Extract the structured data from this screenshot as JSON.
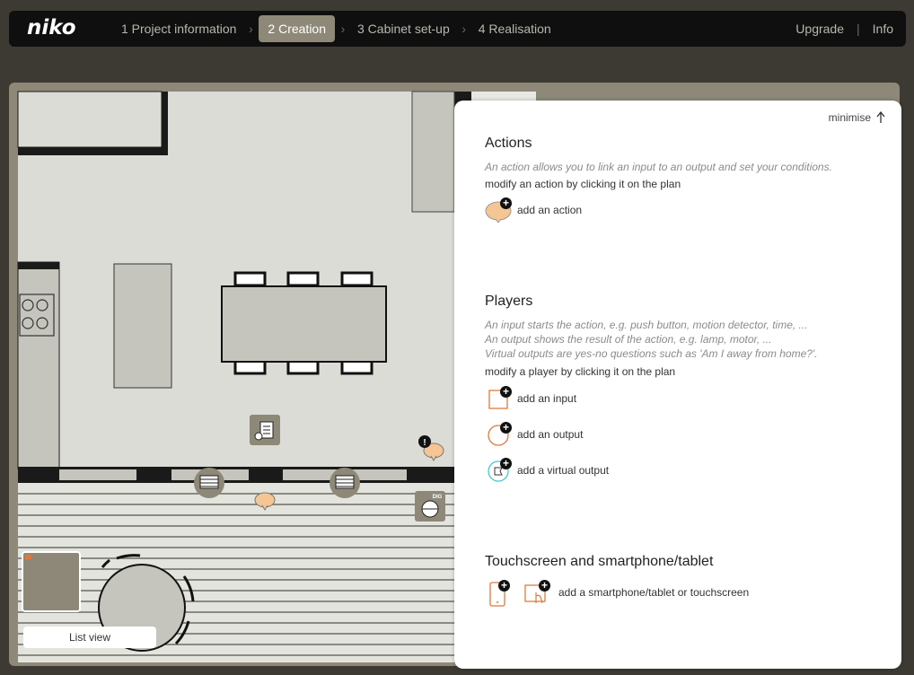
{
  "nav": {
    "logo": "niko",
    "steps": [
      {
        "label": "1 Project information"
      },
      {
        "label": "2 Creation",
        "active": true
      },
      {
        "label": "3 Cabinet set-up"
      },
      {
        "label": "4 Realisation"
      }
    ],
    "upgrade_label": "Upgrade",
    "separator": "|",
    "info_label": "Info"
  },
  "panel": {
    "minimise_label": "minimise",
    "actions": {
      "title": "Actions",
      "description": "An action allows you to link an input to an output and set your conditions.",
      "note": "modify an action by clicking it on the plan",
      "add_action_label": "add an action"
    },
    "players": {
      "title": "Players",
      "desc_line1": "An input starts the action, e.g. push button, motion detector, time, ...",
      "desc_line2": "An output shows the result of the action, e.g. lamp, motor, ...",
      "desc_line3": "Virtual outputs are yes-no questions such as 'Am I away from home?'.",
      "note": "modify a player by clicking it on the plan",
      "add_input_label": "add an input",
      "add_output_label": "add an output",
      "add_virtual_label": "add a virtual output"
    },
    "touchscreen": {
      "title": "Touchscreen and smartphone/tablet",
      "add_device_label": "add a smartphone/tablet or touchscreen"
    }
  },
  "plan": {
    "list_view_label": "List view",
    "dig_label": "DIG",
    "alert_symbol": "!"
  },
  "colors": {
    "accent_orange": "#e2783a",
    "action_bubble": "#f5c593",
    "virtual_cyan": "#49c7d2",
    "workspace_bg": "#8d8878",
    "room_floor": "#dcdcd6",
    "deck": "#e4e4de"
  },
  "icons": [
    "chevron-right-icon",
    "arrow-up-icon",
    "action-bubble-icon",
    "plus-icon",
    "input-icon",
    "output-icon",
    "virtual-output-icon",
    "smartphone-icon",
    "touchscreen-icon",
    "blind-icon",
    "motion-detector-icon",
    "alert-icon"
  ]
}
